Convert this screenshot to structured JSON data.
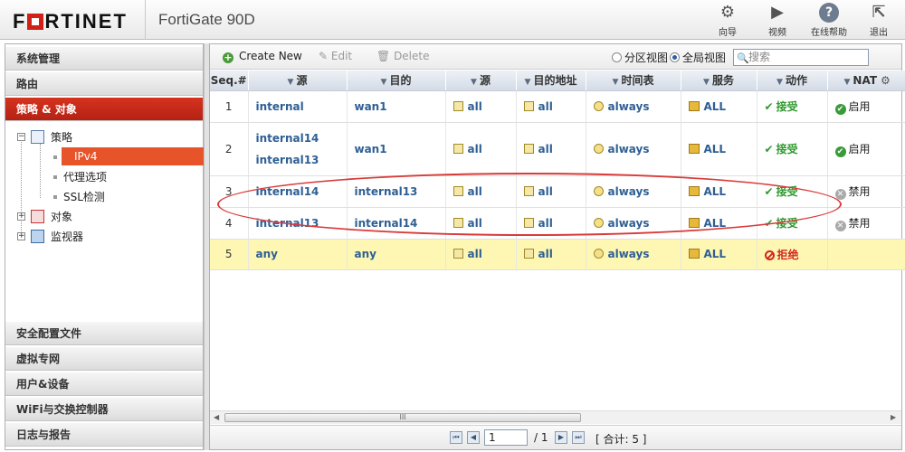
{
  "brand": {
    "logo": "FORTINET",
    "product": "FortiGate 90D"
  },
  "topbar_buttons": [
    {
      "label": "向导",
      "icon": "wizard-icon"
    },
    {
      "label": "视频",
      "icon": "video-icon"
    },
    {
      "label": "在线帮助",
      "icon": "help-icon"
    },
    {
      "label": "退出",
      "icon": "logout-icon"
    }
  ],
  "sidebar": {
    "sections_top": [
      "系统管理",
      "路由",
      "策略 & 对象"
    ],
    "sections_bottom": [
      "安全配置文件",
      "虚拟专网",
      "用户&设备",
      "WiFi与交换控制器",
      "日志与报告"
    ],
    "tree": {
      "policy": "策略",
      "ipv4": "IPv4",
      "proxy": "代理选项",
      "ssl": "SSL检测",
      "objects": "对象",
      "monitor": "监视器"
    }
  },
  "toolbar": {
    "create_new": "Create New",
    "edit": "Edit",
    "delete": "Delete",
    "view_section": "分区视图",
    "view_global": "全局视图",
    "search_placeholder": "搜索"
  },
  "table": {
    "headers": [
      "Seq.#",
      "源",
      "目的",
      "源",
      "目的地址",
      "时间表",
      "服务",
      "动作",
      "NAT"
    ],
    "rows": [
      {
        "seq": "1",
        "src_if": [
          "internal"
        ],
        "dst_if": [
          "wan1"
        ],
        "src": "all",
        "dst": "all",
        "schedule": "always",
        "service": "ALL",
        "action": "接受",
        "nat": "启用"
      },
      {
        "seq": "2",
        "src_if": [
          "internal14",
          "internal13"
        ],
        "dst_if": [
          "wan1"
        ],
        "src": "all",
        "dst": "all",
        "schedule": "always",
        "service": "ALL",
        "action": "接受",
        "nat": "启用"
      },
      {
        "seq": "3",
        "src_if": [
          "internal14"
        ],
        "dst_if": [
          "internal13"
        ],
        "src": "all",
        "dst": "all",
        "schedule": "always",
        "service": "ALL",
        "action": "接受",
        "nat": "禁用"
      },
      {
        "seq": "4",
        "src_if": [
          "internal13"
        ],
        "dst_if": [
          "internal14"
        ],
        "src": "all",
        "dst": "all",
        "schedule": "always",
        "service": "ALL",
        "action": "接受",
        "nat": "禁用"
      },
      {
        "seq": "5",
        "src_if": [
          "any"
        ],
        "dst_if": [
          "any"
        ],
        "src": "all",
        "dst": "all",
        "schedule": "always",
        "service": "ALL",
        "action": "拒绝",
        "nat": ""
      }
    ]
  },
  "pager": {
    "page": "1",
    "of": "/ 1",
    "total": "[ 合计: 5 ]"
  },
  "colors": {
    "accent_red": "#c0291a",
    "selected_orange": "#e8542a",
    "link_blue": "#2e5f94",
    "deny_row": "#fdf7b3",
    "annotation_red": "#d93a3a"
  }
}
